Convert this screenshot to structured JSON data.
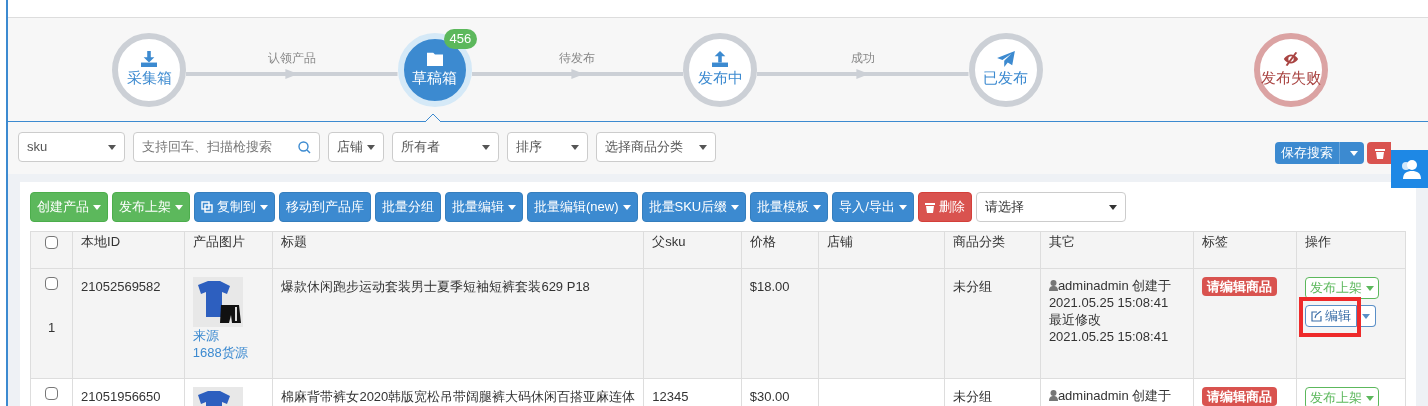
{
  "steps": [
    {
      "label": "采集箱",
      "selected": false,
      "kind": "normal"
    },
    {
      "label": "草稿箱",
      "selected": true,
      "kind": "normal",
      "badge": "456"
    },
    {
      "label": "发布中",
      "selected": false,
      "kind": "normal"
    },
    {
      "label": "已发布",
      "selected": false,
      "kind": "normal"
    },
    {
      "label": "发布失败",
      "selected": false,
      "kind": "failed"
    }
  ],
  "connectors": [
    "认领产品",
    "待发布",
    "成功"
  ],
  "filters": [
    {
      "kind": "select",
      "value": "sku"
    },
    {
      "kind": "search",
      "placeholder": "支持回车、扫描枪搜索"
    },
    {
      "kind": "dropdown",
      "value": "店铺"
    },
    {
      "kind": "select",
      "value": "所有者"
    },
    {
      "kind": "select",
      "value": "排序"
    },
    {
      "kind": "select",
      "value": "选择商品分类"
    }
  ],
  "save_search": "保存搜索",
  "toolbar": [
    {
      "label": "创建产品",
      "kind": "success",
      "caret": true
    },
    {
      "label": "发布上架",
      "kind": "success",
      "caret": true
    },
    {
      "label": "复制到",
      "kind": "primary",
      "caret": true
    },
    {
      "label": "移动到产品库",
      "kind": "primary",
      "caret": false
    },
    {
      "label": "批量分组",
      "kind": "primary",
      "caret": false
    },
    {
      "label": "批量编辑",
      "kind": "primary",
      "caret": true
    },
    {
      "label": "批量编辑(new)",
      "kind": "primary",
      "caret": true
    },
    {
      "label": "批量SKU后缀",
      "kind": "primary",
      "caret": true
    },
    {
      "label": "批量模板",
      "kind": "primary",
      "caret": true
    },
    {
      "label": "导入/导出",
      "kind": "primary",
      "caret": true
    },
    {
      "label": "删除",
      "kind": "danger",
      "caret": false
    }
  ],
  "toolbar_select": "请选择",
  "table": {
    "header_checked": false,
    "columns": [
      "本地ID",
      "产品图片",
      "标题",
      "父sku",
      "价格",
      "店铺",
      "商品分类",
      "其它",
      "标签",
      "操作"
    ],
    "rows": [
      {
        "checked": false,
        "index": "1",
        "id": "21052569582",
        "links": [
          "来源",
          "1688货源"
        ],
        "title": "爆款休闲跑步运动套装男士夏季短袖短裤套装629 P18",
        "parent_sku": "",
        "price": "$18.00",
        "category": "未分组",
        "other": [
          "adminadmin 创建于",
          "2021.05.25 15:08:41",
          "最近修改",
          "2021.05.25 15:08:41"
        ],
        "tag": "请编辑商品",
        "publish": "发布上架",
        "edit": "编辑",
        "highlighted": true
      },
      {
        "checked": false,
        "id": "21051956650",
        "links": [],
        "title": "棉麻背带裤女2020韩版宽松吊带阔腿裤大码休闲百搭亚麻连体",
        "parent_sku": "12345",
        "price": "$30.00",
        "category": "未分组",
        "other": [
          "adminadmin 创建于"
        ],
        "tag": "请编辑商品",
        "publish": "发布上架",
        "highlighted": false
      }
    ]
  }
}
